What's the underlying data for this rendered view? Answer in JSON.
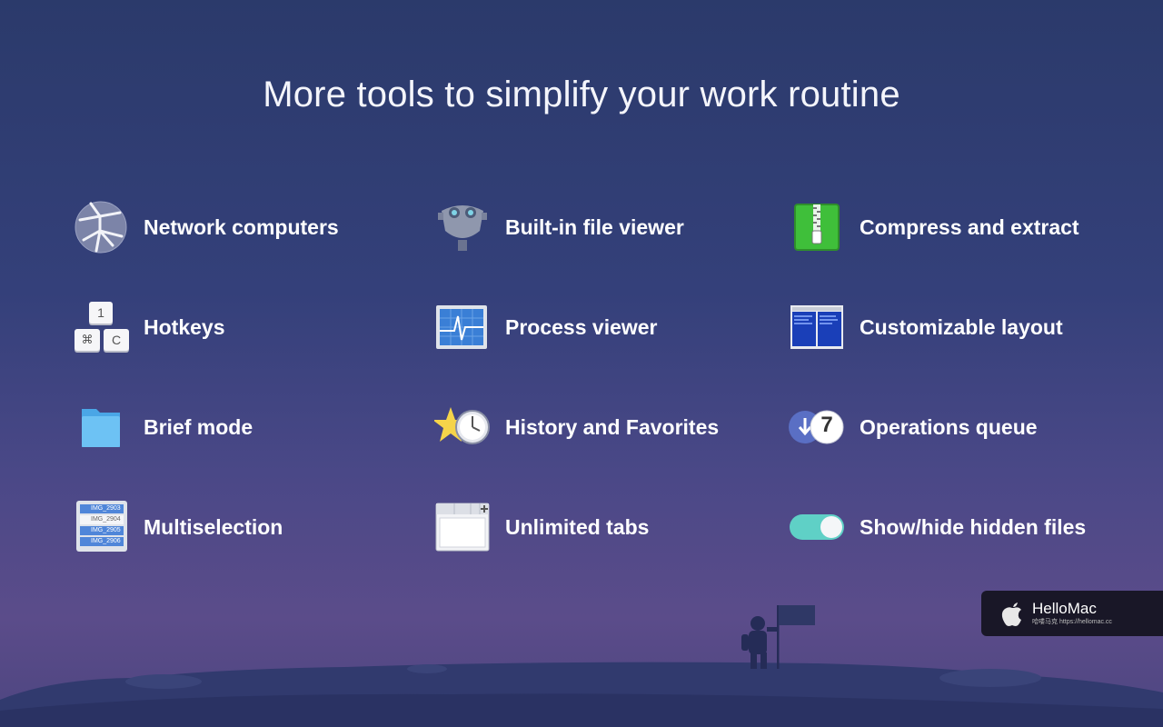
{
  "title": "More tools to simplify your work routine",
  "features": [
    {
      "label": "Network computers",
      "icon": "globe-network-icon"
    },
    {
      "label": "Built-in file viewer",
      "icon": "binocular-viewer-icon"
    },
    {
      "label": "Compress and extract",
      "icon": "zip-archive-icon"
    },
    {
      "label": "Hotkeys",
      "icon": "keyboard-keys-icon"
    },
    {
      "label": "Process viewer",
      "icon": "activity-monitor-icon"
    },
    {
      "label": "Customizable layout",
      "icon": "layout-window-icon"
    },
    {
      "label": "Brief mode",
      "icon": "folder-icon"
    },
    {
      "label": "History and Favorites",
      "icon": "star-clock-icon"
    },
    {
      "label": "Operations queue",
      "icon": "queue-download-icon"
    },
    {
      "label": "Multiselection",
      "icon": "file-list-icon"
    },
    {
      "label": "Unlimited tabs",
      "icon": "tabs-window-icon"
    },
    {
      "label": "Show/hide hidden files",
      "icon": "toggle-switch-icon"
    }
  ],
  "keys": {
    "k1": "1",
    "cmd": "⌘",
    "c": "C"
  },
  "queue_count": "7",
  "file_list": [
    "IMG_2903",
    "IMG_2904",
    "IMG_2905",
    "IMG_2906"
  ],
  "badge": {
    "brand": "HelloMac",
    "sub": "哈喽马克 https://hellomac.cc"
  },
  "colors": {
    "accent_green": "#3fbf3a",
    "toggle_teal": "#5fd0c6",
    "folder_blue": "#5bb8f0"
  }
}
